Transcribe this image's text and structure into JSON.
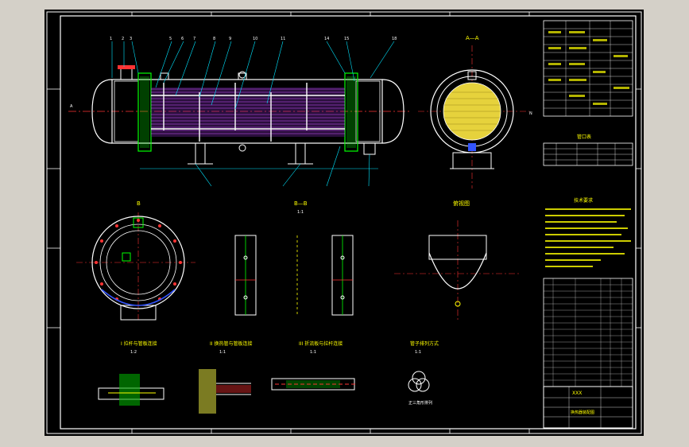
{
  "section_a": {
    "label": "A—A"
  },
  "view_b": {
    "label": "B"
  },
  "section_b": {
    "label": "B—B",
    "scale": "1:1"
  },
  "front_view": {
    "label": "俯视图"
  },
  "detail_1": {
    "title": "I 拉杆与管板连接",
    "scale": "1:2"
  },
  "detail_2": {
    "title": "II 换热管与管板连接",
    "scale": "1:1"
  },
  "detail_3": {
    "title": "III 折流板与拉杆连接",
    "scale": "1:1"
  },
  "detail_4": {
    "title": "管子排列方式",
    "scale": "1:1",
    "caption": "正三角形排列"
  },
  "tech_notes": {
    "title": "技术要求"
  },
  "nozzle_table": {
    "title": "管口表"
  },
  "title_block": {
    "drawing_name": "换热器装配图",
    "company": "XXX"
  },
  "colors": {
    "frame": "#ffffff",
    "vessel": "#ffffff",
    "tubes": "#cc55ff",
    "flange": "#00ff00",
    "centerline": "#ff3333",
    "dimension": "#00e5ff",
    "text": "#ffff00",
    "hatch": "#ffdd33"
  }
}
